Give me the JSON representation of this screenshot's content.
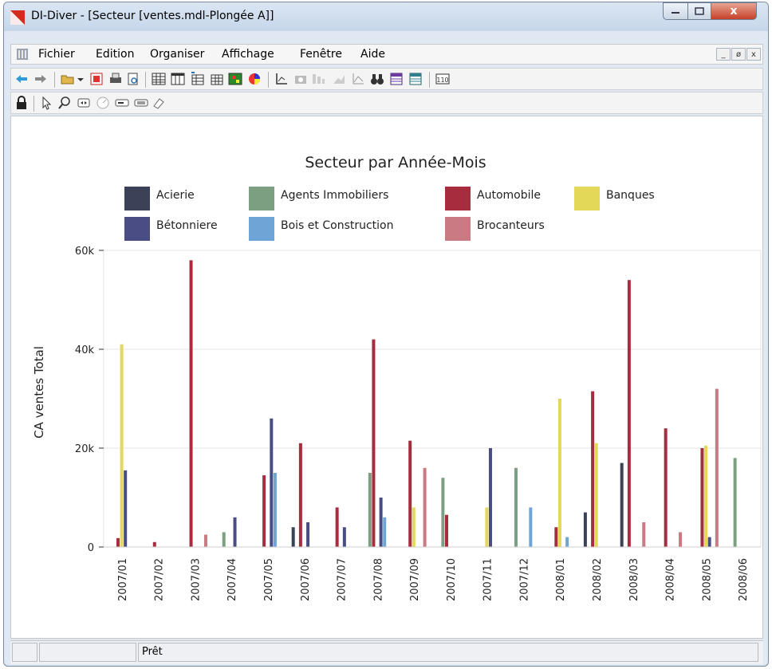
{
  "window": {
    "title": "DI-Diver - [Secteur [ventes.mdl-Plongée A]]",
    "close_label": "x"
  },
  "menu": {
    "items": [
      "Fichier",
      "Edition",
      "Organiser",
      "Affichage",
      "Fenêtre",
      "Aide"
    ],
    "mdi_buttons": [
      "_",
      "ø",
      "x"
    ]
  },
  "toolbar1": {
    "icons": [
      "back-arrow-icon",
      "forward-arrow-icon",
      "open-folder-icon",
      "dropdown-icon",
      "export-red-icon",
      "print-icon",
      "print-preview-icon",
      "table-icon",
      "columns-icon",
      "insert-column-icon",
      "insert-row-icon",
      "color-grid-icon",
      "pie-3d-icon",
      "chart-axis-icon",
      "camera-icon",
      "bar-layout-icon",
      "area-chart-icon",
      "line-chart-icon",
      "binoculars-icon",
      "calendar-purple-icon",
      "calendar-teal-icon",
      "counter-icon"
    ]
  },
  "toolbar2": {
    "icons": [
      "lock-icon",
      "pointer-icon",
      "zoom-icon",
      "expand-icon",
      "clock-icon",
      "label-icon",
      "list-icon",
      "eraser-icon"
    ]
  },
  "status": {
    "text": "Prêt"
  },
  "chart_data": {
    "type": "bar",
    "title": "Secteur par Année-Mois",
    "xlabel": "",
    "ylabel": "CA ventes Total",
    "ylim": [
      0,
      60000
    ],
    "y_ticks": [
      {
        "value": 0,
        "label": "0"
      },
      {
        "value": 20000,
        "label": "20k"
      },
      {
        "value": 40000,
        "label": "40k"
      },
      {
        "value": 60000,
        "label": "60k"
      }
    ],
    "grid": true,
    "legend_position": "top",
    "categories": [
      "2007/01",
      "2007/02",
      "2007/03",
      "2007/04",
      "2007/05",
      "2007/06",
      "2007/07",
      "2007/08",
      "2007/09",
      "2007/10",
      "2007/11",
      "2007/12",
      "2008/01",
      "2008/02",
      "2008/03",
      "2008/04",
      "2008/05",
      "2008/06"
    ],
    "series": [
      {
        "name": "Acierie",
        "color": "#3b4258",
        "values": [
          0,
          0,
          0,
          0,
          0,
          4000,
          0,
          0,
          0,
          0,
          0,
          0,
          0,
          7000,
          17000,
          0,
          0,
          0
        ]
      },
      {
        "name": "Agents Immobiliers",
        "color": "#7c9f82",
        "values": [
          0,
          0,
          0,
          3000,
          0,
          0,
          0,
          15000,
          0,
          14000,
          0,
          16000,
          0,
          0,
          0,
          0,
          0,
          18000
        ]
      },
      {
        "name": "Automobile",
        "color": "#a72c3e",
        "values": [
          1800,
          1000,
          58000,
          0,
          14500,
          21000,
          8000,
          42000,
          21500,
          6500,
          0,
          0,
          4000,
          31500,
          54000,
          24000,
          20000,
          0
        ]
      },
      {
        "name": "Banques",
        "color": "#e3d857",
        "values": [
          41000,
          0,
          0,
          0,
          0,
          0,
          0,
          0,
          8000,
          0,
          8000,
          0,
          30000,
          21000,
          0,
          0,
          20500,
          0
        ]
      },
      {
        "name": "Bétonniere",
        "color": "#4a4d83",
        "values": [
          15500,
          0,
          0,
          6000,
          26000,
          5000,
          4000,
          10000,
          0,
          0,
          20000,
          0,
          0,
          0,
          0,
          0,
          2000,
          0
        ]
      },
      {
        "name": "Bois et Construction",
        "color": "#6fa4d6",
        "values": [
          0,
          0,
          0,
          0,
          15000,
          0,
          0,
          6000,
          0,
          0,
          0,
          8000,
          2000,
          0,
          0,
          0,
          0,
          0
        ]
      },
      {
        "name": "Brocanteurs",
        "color": "#c97a83",
        "values": [
          0,
          0,
          2500,
          0,
          0,
          0,
          0,
          0,
          16000,
          0,
          0,
          0,
          0,
          0,
          5000,
          3000,
          32000,
          0
        ]
      }
    ]
  }
}
